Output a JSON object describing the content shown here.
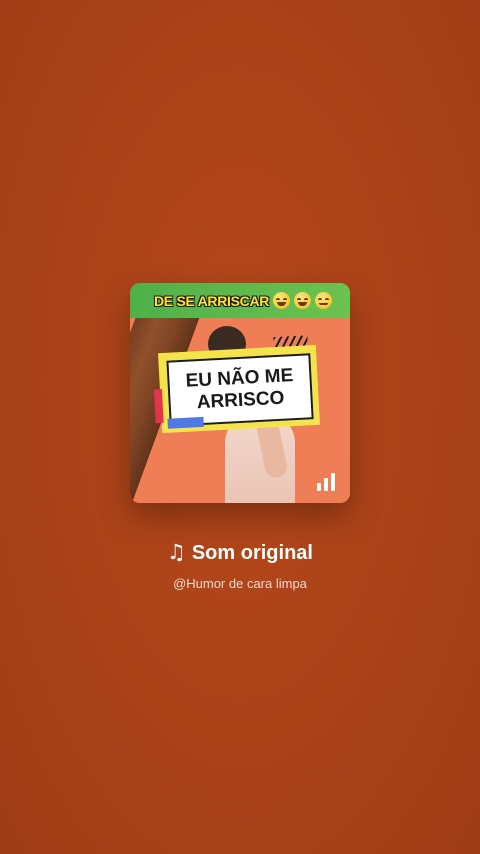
{
  "audio": {
    "cover": {
      "top_banner_text": "DE SE ARRISCAR",
      "top_banner_emojis": [
        "laughing-emoji",
        "laughing-emoji",
        "relieved-emoji"
      ],
      "caption_line1": "EU NÃO ME",
      "caption_line2": "ARRISCO",
      "playing_indicator_icon": "audio-bars-icon"
    },
    "title_icon": "music-note-icon",
    "title_glyph": "♫",
    "title": "Som original",
    "author": "@Humor de cara limpa"
  },
  "colors": {
    "background": "#ac4319",
    "banner_green": "#4fb04a",
    "banner_text": "#ffe433",
    "caption_frame": "#f4e34b",
    "caption_red": "#e2344b",
    "caption_blue": "#4f78e8",
    "photo_background": "#ef7e57",
    "title_text": "#ffffff",
    "author_text": "#f3d8cc"
  }
}
